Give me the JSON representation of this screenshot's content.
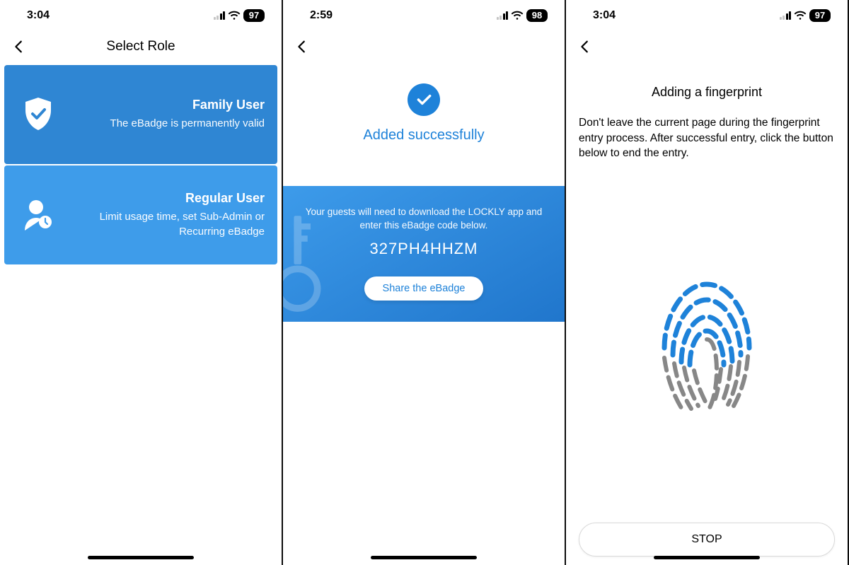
{
  "screens": [
    {
      "status": {
        "time": "3:04",
        "battery": "97"
      },
      "nav_title": "Select Role",
      "roles": [
        {
          "icon": "shield-check-icon",
          "title": "Family User",
          "subtitle": "The eBadge is permanently valid"
        },
        {
          "icon": "user-clock-icon",
          "title": "Regular User",
          "subtitle": "Limit usage time, set Sub-Admin or Recurring eBadge"
        }
      ]
    },
    {
      "status": {
        "time": "2:59",
        "battery": "98"
      },
      "success_label": "Added successfully",
      "panel_instruction": "Your guests will need to download the LOCKLY app and enter this eBadge code below.",
      "ebadge_code": "327PH4HHZM",
      "share_button": "Share the eBadge"
    },
    {
      "status": {
        "time": "3:04",
        "battery": "97"
      },
      "fp_title": "Adding a fingerprint",
      "fp_instruction": "Don't leave the current page during the fingerprint entry process. After successful entry, click the button below to end the entry.",
      "stop_button": "STOP"
    }
  ]
}
